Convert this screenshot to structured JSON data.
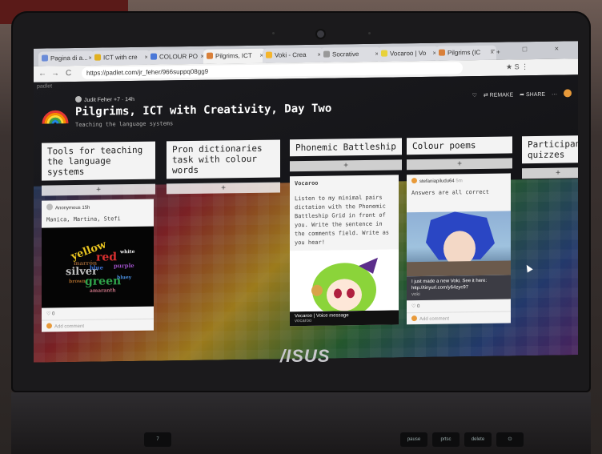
{
  "browser": {
    "tabs": [
      {
        "label": "Pagina di a...",
        "color": "#6b8cd8"
      },
      {
        "label": "ICT with cre",
        "color": "#e0b020"
      },
      {
        "label": "COLOUR PO",
        "color": "#4a78d8"
      },
      {
        "label": "Pilgrims, ICT",
        "color": "#d9803a",
        "active": true
      },
      {
        "label": "Voki - Crea",
        "color": "#f5b52a"
      },
      {
        "label": "Socrative",
        "color": "#999999"
      },
      {
        "label": "Vocaroo | Vo",
        "color": "#e8d23a"
      },
      {
        "label": "Pilgrims (IC",
        "color": "#d9803a"
      }
    ],
    "new_tab": "+",
    "window_buttons": "– □ ×",
    "back": "←",
    "forward": "→",
    "reload": "C",
    "url": "https://padlet.com/jr_feher/966suppq08gg9",
    "toolbar_icons": "★  S  ⋮"
  },
  "padlet": {
    "brand_label": "padlet",
    "author": "Judit Feher",
    "author_meta": "+7 · 14h",
    "title": "Pilgrims, ICT with Creativity, Day Two",
    "subtitle": "Teaching the language systems",
    "actions": {
      "heart": "♡",
      "remake": "⇄ REMAKE",
      "share": "➦ SHARE",
      "more": "···"
    }
  },
  "columns": [
    {
      "title": "Tools for teaching the language systems",
      "add": "+"
    },
    {
      "title": "Pron dictionaries task with colour words",
      "add": "+"
    },
    {
      "title": "Phonemic Battleship",
      "add": "+"
    },
    {
      "title": "Colour poems",
      "add": "+"
    },
    {
      "title": "Participant quizzes",
      "add": "+"
    }
  ],
  "cards": {
    "col1": {
      "author": "Anonymous",
      "time": "15h",
      "body": "Manica, Martina, Stefi",
      "likes": "♡ 0",
      "comment": "Add comment",
      "wordcloud": [
        "yellow",
        "red",
        "white",
        "purple",
        "silver",
        "green",
        "brown",
        "bluey",
        "marrón",
        "blue",
        "amaranth"
      ]
    },
    "col3": {
      "head": "Vocaroo",
      "body": "Listen to my minimal pairs dictation with the Phonemic Battleship Grid in front of you. Write the sentence in the comments field. Write as you hear!",
      "caption": "Vocaroo | Voice message",
      "caption_sub": "vocaroo"
    },
    "col4": {
      "author": "stefaniapiludu64",
      "time": "5m",
      "body": "Answers are all correct",
      "voki_text": "I just made a new Voki. See it here: http://tinyurl.com/y64zyc97",
      "voki_sub": "voki",
      "likes": "♡ 0",
      "comment": "Add comment"
    }
  },
  "laptop": {
    "brand": "/ISUS"
  },
  "keyboard": [
    "7",
    "pause",
    "prtsc",
    "delete",
    "⏻"
  ]
}
